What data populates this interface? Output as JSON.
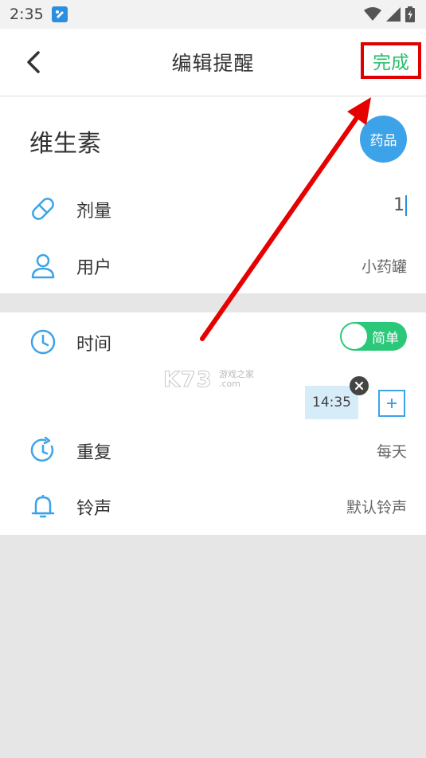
{
  "status_bar": {
    "time": "2:35"
  },
  "header": {
    "title": "编辑提醒",
    "done_label": "完成"
  },
  "medicine": {
    "name": "维生素",
    "category": "药品"
  },
  "fields": {
    "dosage": {
      "label": "剂量",
      "value": "1",
      "icon": "pill-icon"
    },
    "user": {
      "label": "用户",
      "value": "小药罐",
      "icon": "user-icon"
    },
    "time": {
      "label": "时间",
      "icon": "clock-icon",
      "mode_toggle_label": "简单",
      "mode_toggle_on": true,
      "times": [
        "14:35"
      ]
    },
    "repeat": {
      "label": "重复",
      "value": "每天",
      "icon": "repeat-clock-icon"
    },
    "ringtone": {
      "label": "铃声",
      "value": "默认铃声",
      "icon": "bell-icon"
    }
  },
  "watermark": {
    "logo": "K73",
    "site": "游戏之家",
    "domain": ".com"
  },
  "colors": {
    "accent": "#3da3e8",
    "done_text": "#2bbf6a",
    "toggle_on": "#2bc87a",
    "highlight_box": "#e00000",
    "annotation_arrow": "#e60000"
  }
}
